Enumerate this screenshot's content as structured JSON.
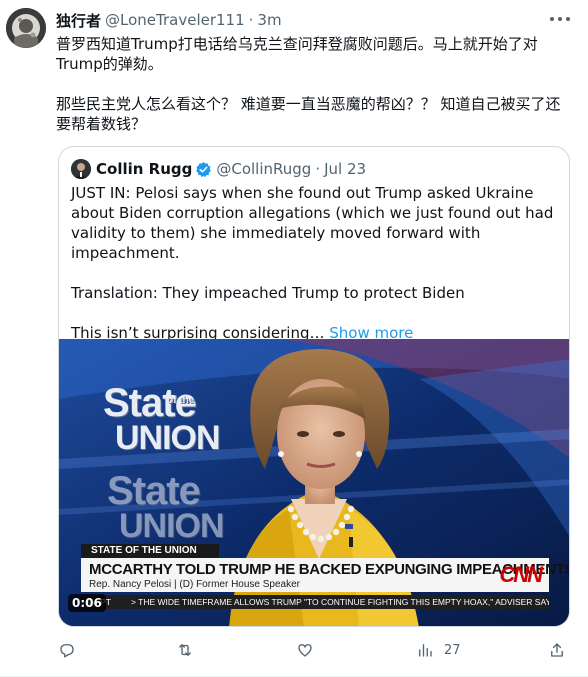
{
  "tweet": {
    "display_name": "独行者",
    "handle": "@LoneTraveler111",
    "separator": "·",
    "time": "3m",
    "text": "普罗西知道Trump打电话给乌克兰查问拜登腐败问题后。马上就开始了对Trump的弹劾。\n\n那些民主党人怎么看这个？ 难道要一直当恶魔的帮凶？？ 知道自己被买了还要帮着数钱？"
  },
  "quote": {
    "display_name": "Collin Rugg",
    "handle": "@CollinRugg",
    "separator": "·",
    "time": "Jul 23",
    "text_main": "JUST IN: Pelosi says when she found out Trump asked Ukraine about Biden corruption allegations (which we just found out had validity to them) she immediately moved forward with impeachment.\n\nTranslation: They impeached Trump to protect Biden\n\nThis isn’t surprising considering… ",
    "show_more": "Show more"
  },
  "video": {
    "duration": "0:06",
    "brand_top": "State",
    "brand_of": "of the",
    "brand_union": "UNION",
    "tag": "STATE OF THE UNION",
    "headline": "MCCARTHY TOLD TRUMP HE BACKED EXPUNGING IMPEACHMENTS",
    "subline": "Rep. Nancy Pelosi   |   (D) Former House Speaker",
    "network": "CNN",
    "ticker_time": "AM PT",
    "ticker": "> THE WIDE TIMEFRAME ALLOWS TRUMP \"TO CONTINUE FIGHTING THIS EMPTY HOAX,\" ADVISER SAYS"
  },
  "actions": {
    "reply_count": "",
    "retweet_count": "",
    "like_count": "",
    "views_count": "27"
  },
  "colors": {
    "accent": "#1d9bf0",
    "secondary_text": "#536471",
    "border": "#cfd9de",
    "cnn_red": "#cc0000"
  },
  "icons": [
    "more-icon",
    "verified-badge-icon",
    "reply-icon",
    "retweet-icon",
    "like-icon",
    "views-icon",
    "share-icon"
  ]
}
